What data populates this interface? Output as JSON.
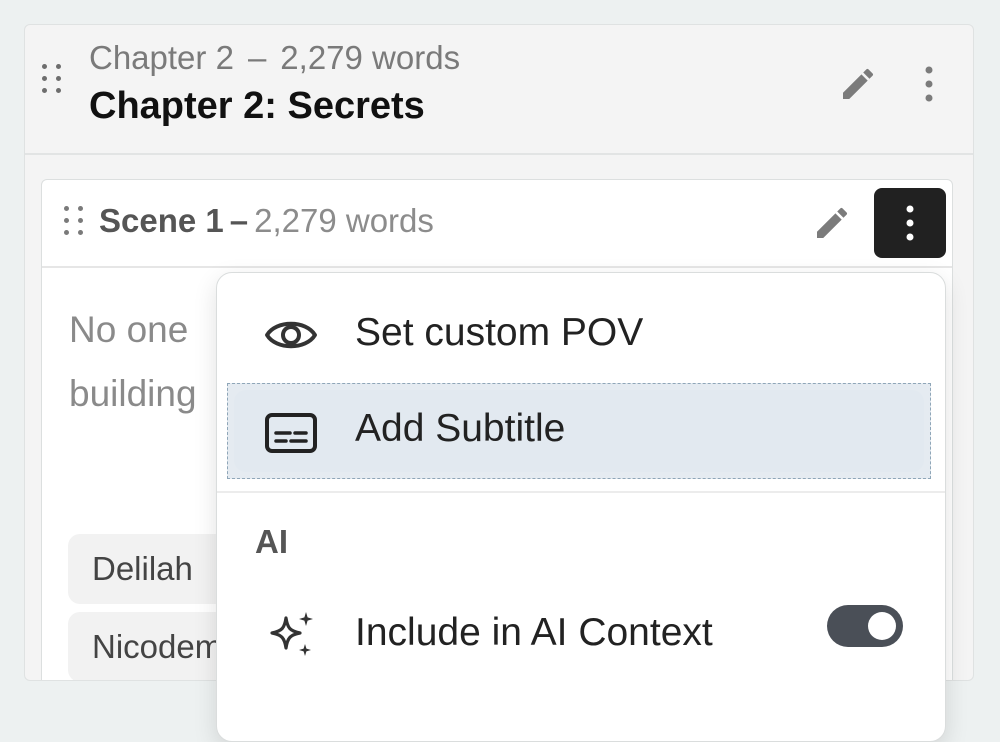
{
  "chapter": {
    "meta_label": "Chapter 2",
    "meta_separator": "–",
    "word_count": "2,279 words",
    "title": "Chapter 2: Secrets"
  },
  "scene": {
    "name": "Scene 1",
    "separator": "–",
    "word_count": "2,279 words",
    "preview_line_1": "No one",
    "preview_line_2": "building",
    "tags": [
      "Delilah",
      "Nicodemus"
    ]
  },
  "menu": {
    "items": [
      {
        "label": "Set custom POV",
        "icon": "eye-icon"
      },
      {
        "label": "Add Subtitle",
        "icon": "subtitles-icon"
      }
    ],
    "section_ai": "AI",
    "ai_item": {
      "label": "Include in AI Context",
      "icon": "sparkles-icon",
      "toggle_on": true
    }
  },
  "colors": {
    "background": "#edf1f1",
    "menu_highlight": "#e2e9f0",
    "toggle_on": "#4a4f57",
    "dark_button": "#212121"
  }
}
